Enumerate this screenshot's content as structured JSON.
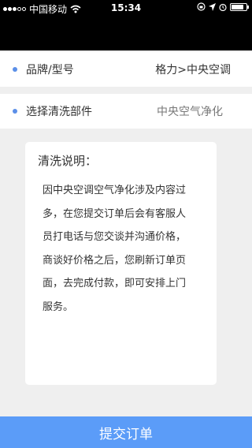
{
  "status_bar": {
    "carrier": "中国移动",
    "time": "15:34",
    "battery_level": 0.85
  },
  "brand_row": {
    "label": "品牌/型号",
    "value": "格力>中央空调"
  },
  "part_row": {
    "label": "选择清洗部件",
    "value": "中央空气净化"
  },
  "notice": {
    "title": "清洗说明：",
    "body": "因中央空调空气净化涉及内容过\n多，在您提交订单后会有客服人\n员打电话与您交谈并沟通价格，\n商谈好价格之后，您刷新订单页\n面，去完成付款，即可安排上门\n服务。"
  },
  "submit_label": "提交订单",
  "colors": {
    "accent": "#5b9cf8",
    "bullet": "#5b8fe8"
  }
}
